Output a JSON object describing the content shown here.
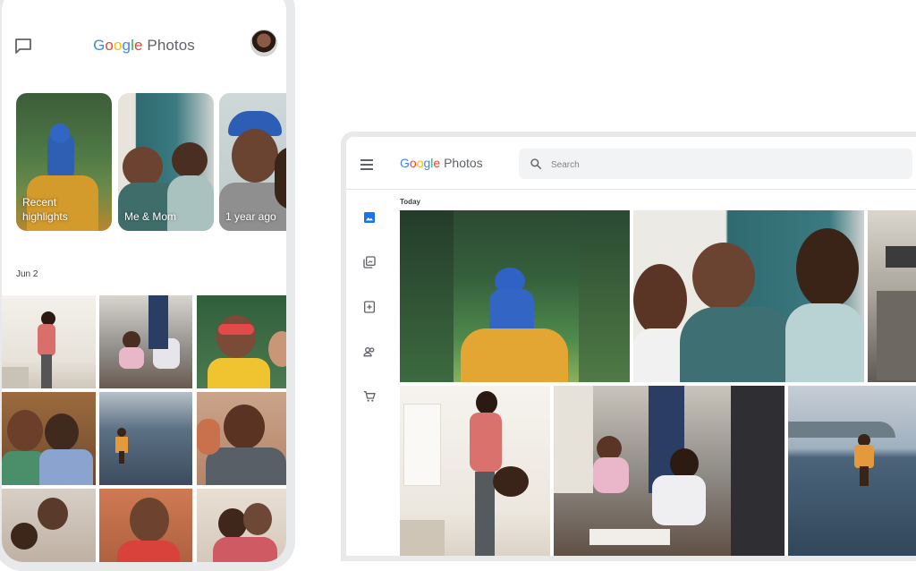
{
  "colors": {
    "blue": "#4285F4",
    "red": "#EA4335",
    "yellow": "#FBBC05",
    "green": "#34A853",
    "grey_text": "#5f6368"
  },
  "phone": {
    "logo": {
      "google": "Google",
      "photos": "Photos"
    },
    "icons": {
      "chat": "chat-bubble-icon",
      "avatar": "profile-avatar"
    },
    "memories": [
      {
        "label": "Recent\nhighlights"
      },
      {
        "label": "Me & Mom"
      },
      {
        "label": "1 year ago"
      }
    ],
    "date_header": "Jun 2"
  },
  "browser": {
    "logo": {
      "google": "Google",
      "photos": "Photos"
    },
    "search": {
      "placeholder": "Search"
    },
    "date_header": "Today",
    "sidebar_icons": [
      "photos-icon",
      "albums-icon",
      "assistant-icon",
      "sharing-icon",
      "print-store-icon"
    ]
  }
}
